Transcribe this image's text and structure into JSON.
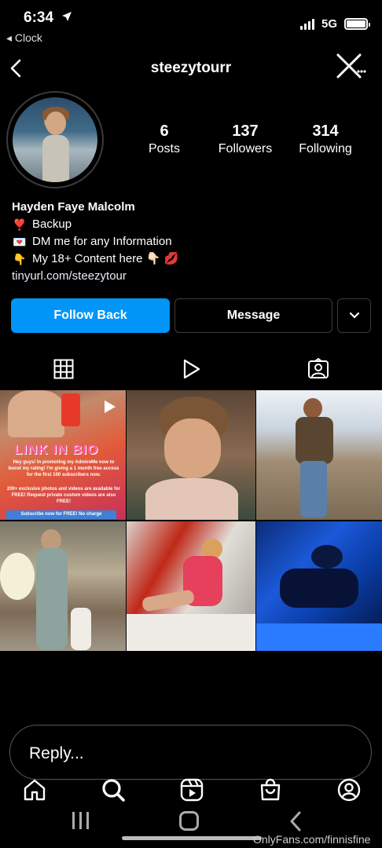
{
  "status_bar": {
    "time": "6:34",
    "back_app": "◂ Clock",
    "network": "5G"
  },
  "header": {
    "username": "steezytourr"
  },
  "profile": {
    "stats": [
      {
        "value": "6",
        "label": "Posts"
      },
      {
        "value": "137",
        "label": "Followers"
      },
      {
        "value": "314",
        "label": "Following"
      }
    ],
    "full_name": "Hayden Faye Malcolm",
    "bio_lines": [
      {
        "emoji": "❣️",
        "text": "Backup"
      },
      {
        "emoji": "💌",
        "text": "DM me for any Information"
      },
      {
        "emoji": "👇",
        "text": "My 18+ Content here 👇🏻 💋"
      }
    ],
    "link": "tinyurl.com/steezytour"
  },
  "actions": {
    "follow_back": "Follow Back",
    "message": "Message",
    "accent_color": "#0095f6"
  },
  "tabs": [
    {
      "icon": "grid-icon",
      "active": true
    },
    {
      "icon": "reels-icon",
      "active": false
    },
    {
      "icon": "tagged-icon",
      "active": false
    }
  ],
  "posts": {
    "first_post": {
      "headline": "LINK IN BIO",
      "text1": "Hey guys! In promoting my AdmireMe now to boost my rating! I'm giving a 1 month free access for the first 100 subscribers now.",
      "text2": "200+ exclusive photos and videos are available for FREE! Request private custom videos are also FREE!",
      "text3": "Subscribe now for FREE! No charge"
    }
  },
  "reply": {
    "placeholder": "Reply..."
  },
  "bottom_nav": [
    "home-icon",
    "search-icon",
    "reels-icon",
    "shop-icon",
    "profile-icon"
  ],
  "watermark": "OnlyFans.com/finnisfine"
}
